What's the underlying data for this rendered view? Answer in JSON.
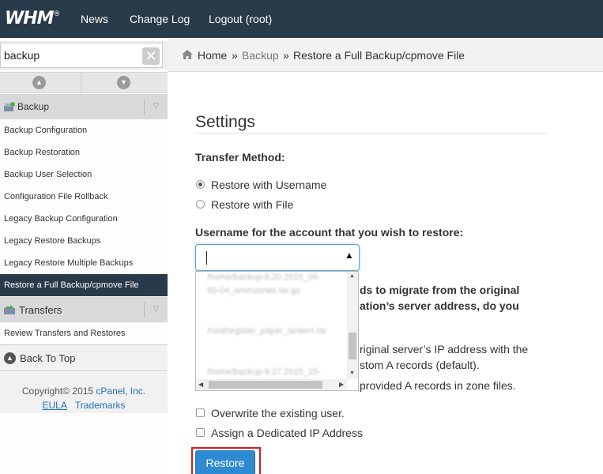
{
  "brand": {
    "logo_text": "WHM",
    "logo_mark": "®"
  },
  "topnav": {
    "items": [
      "News",
      "Change Log",
      "Logout (root)"
    ]
  },
  "sidebar": {
    "search_value": "backup",
    "search_clear_glyph": "✕",
    "collapse_up_glyph": "▲",
    "collapse_down_glyph": "▼",
    "sections": [
      {
        "label": "Backup",
        "icon": "backup-icon",
        "items": [
          "Backup Configuration",
          "Backup Restoration",
          "Backup User Selection",
          "Configuration File Rollback",
          "Legacy Backup Configuration",
          "Legacy Restore Backups",
          "Legacy Restore Multiple Backups",
          "Restore a Full Backup/cpmove File"
        ],
        "active_item": "Restore a Full Backup/cpmove File"
      },
      {
        "label": "Transfers",
        "icon": "transfers-icon",
        "items": [
          "Review Transfers and Restores"
        ]
      }
    ],
    "back_to_top": "Back To Top",
    "footer": {
      "copyright_prefix": "Copyright© 2015 ",
      "company": "cPanel, Inc.",
      "eula": "EULA",
      "trademarks": "Trademarks"
    }
  },
  "breadcrumb": {
    "home": "Home",
    "sep": "»",
    "backup": "Backup",
    "current": "Restore a Full Backup/cpmove File"
  },
  "main": {
    "settings_title": "Settings",
    "transfer_method_label": "Transfer Method:",
    "restore_with_username": "Restore with Username",
    "restore_with_file": "Restore with File",
    "username_label": "Username for the account that you wish to restore:",
    "combo_arrow": "▲",
    "dropdown_options": [
      "/home/backup-8.20.2015_06-",
      "50-04_ommzonec.tar.gz",
      "/root/register_paper_lantern.tar",
      "/home/backup-9.27.2015_15-"
    ],
    "partial_question_line1": "ds to migrate from the original",
    "partial_question_line2": "ation’s server address, do you",
    "partial_option_line1": "riginal server’s IP address with the",
    "partial_option_line2": "stom A records (default).",
    "partial_option2": "provided A records in zone files.",
    "overwrite_user": "Overwrite the existing user.",
    "dedicated_ip": "Assign a Dedicated IP Address",
    "restore_button": "Restore"
  }
}
